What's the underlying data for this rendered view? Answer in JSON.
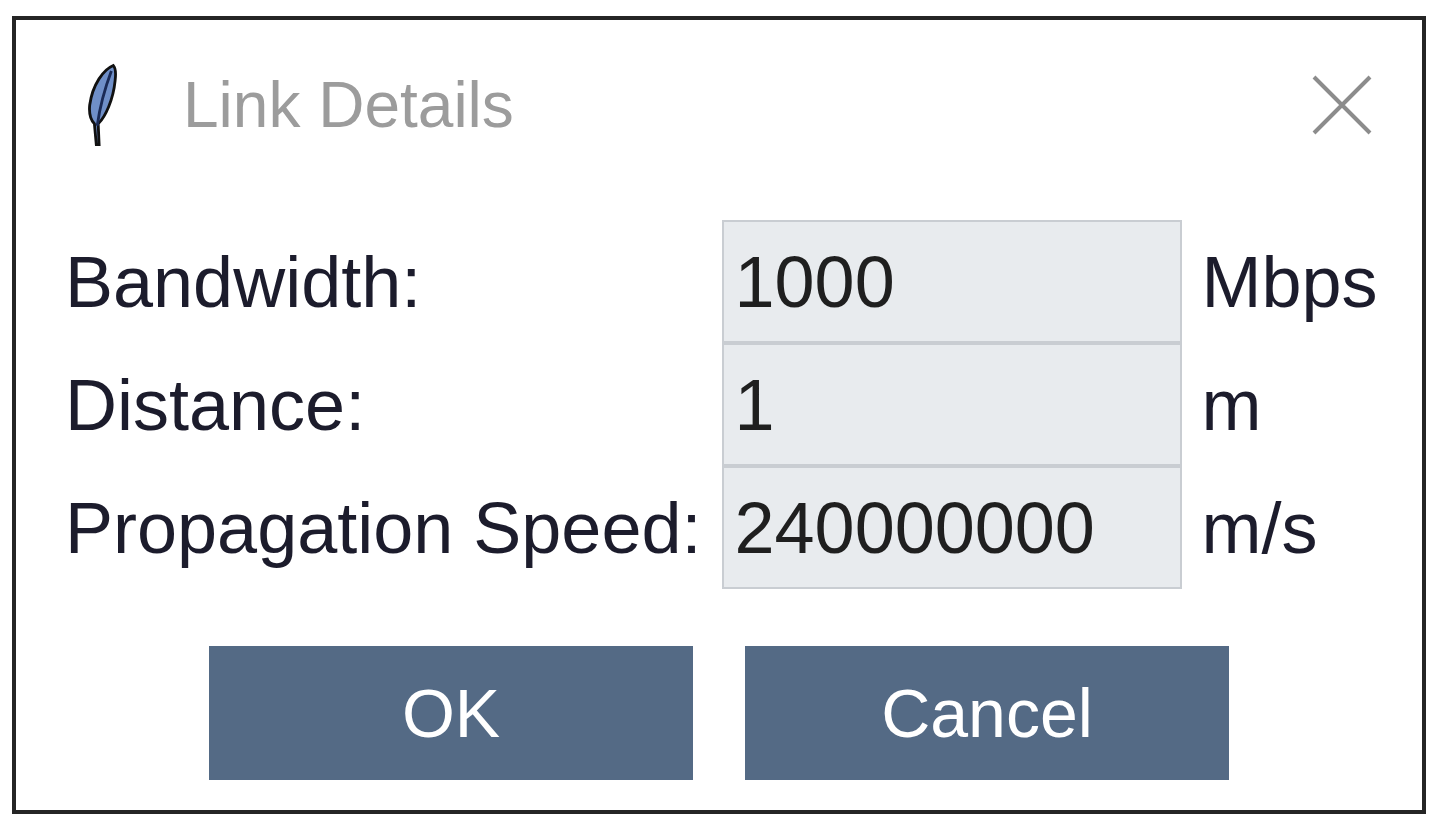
{
  "window": {
    "title": "Link Details"
  },
  "fields": [
    {
      "label": "Bandwidth:",
      "value": "1000",
      "unit": "Mbps"
    },
    {
      "label": "Distance:",
      "value": "1",
      "unit": "m"
    },
    {
      "label": "Propagation Speed:",
      "value": "240000000",
      "unit": "m/s"
    }
  ],
  "buttons": [
    "OK",
    "Cancel"
  ]
}
